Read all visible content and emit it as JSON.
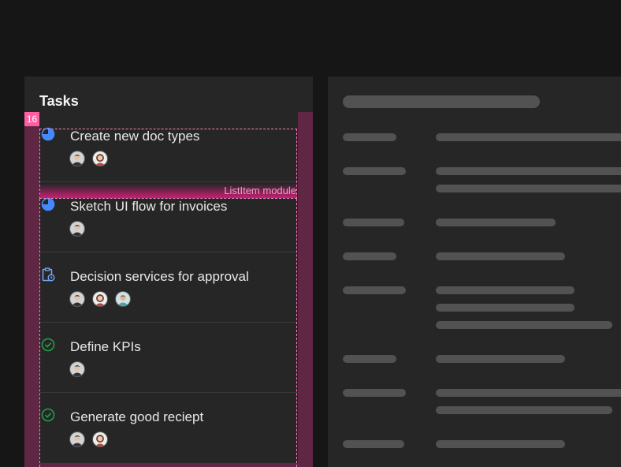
{
  "tasks_panel": {
    "title": "Tasks",
    "spacing_badge": "16",
    "module_label": "ListItem module",
    "tasks": [
      {
        "label": "Create new doc types",
        "status_icon": "in-progress-icon",
        "avatars": [
          "avatar-man",
          "avatar-woman"
        ]
      },
      {
        "label": "Sketch UI flow for invoices",
        "status_icon": "in-progress-icon",
        "avatars": [
          "avatar-man"
        ]
      },
      {
        "label": "Decision services for approval",
        "status_icon": "clipboard-pending-icon",
        "avatars": [
          "avatar-man",
          "avatar-woman",
          "avatar-person"
        ]
      },
      {
        "label": "Define KPIs",
        "status_icon": "checkmark-icon",
        "avatars": [
          "avatar-man"
        ]
      },
      {
        "label": "Generate good reciept",
        "status_icon": "checkmark-icon",
        "avatars": [
          "avatar-man",
          "avatar-woman"
        ]
      }
    ]
  },
  "colors": {
    "background": "#161616",
    "panel": "#262626",
    "in_progress": "#4589ff",
    "pending": "#78a9ff",
    "success": "#24a148",
    "annotation": "#ff7fbf",
    "skeleton": "#525252"
  }
}
